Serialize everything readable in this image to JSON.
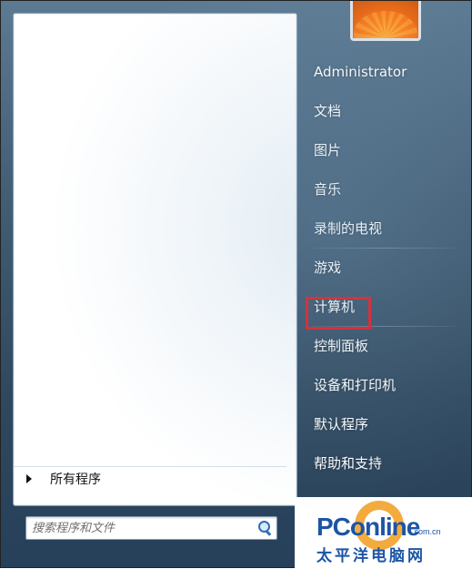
{
  "user": {
    "picture_icon": "flower-user-picture"
  },
  "left_panel": {
    "all_programs_label": "所有程序",
    "search_placeholder": "搜索程序和文件"
  },
  "right_menu": {
    "items": [
      {
        "label": "Administrator"
      },
      {
        "label": "文档"
      },
      {
        "label": "图片"
      },
      {
        "label": "音乐"
      },
      {
        "label": "录制的电视"
      },
      {
        "label": "游戏"
      },
      {
        "label": "计算机"
      },
      {
        "label": "控制面板"
      },
      {
        "label": "设备和打印机"
      },
      {
        "label": "默认程序"
      },
      {
        "label": "帮助和支持"
      }
    ],
    "highlighted_item": "计算机",
    "highlight_color": "#e0181f"
  },
  "watermark": {
    "brand": "PConline",
    "domain": ".com.cn",
    "cn_name": "太平洋电脑网",
    "color": "#1c55a6"
  },
  "colors": {
    "panel_bg": "#2f485e",
    "left_panel_bg": "#ffffff",
    "menu_text": "#ffffff"
  }
}
